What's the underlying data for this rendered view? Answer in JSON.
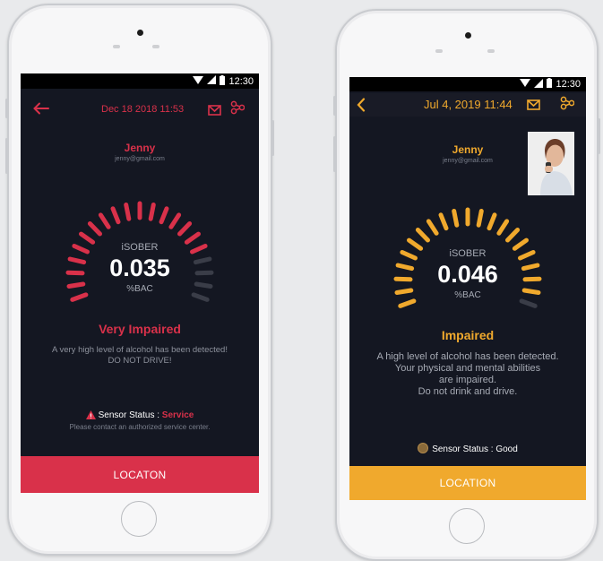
{
  "phones": [
    {
      "status_time": "12:30",
      "date": "Dec 18 2018 11:53",
      "user_name": "Jenny",
      "user_email": "jenny@gmail.com",
      "brand": "iSOBER",
      "reading": "0.035",
      "unit": "%BAC",
      "level_label": "Very Impaired",
      "message_line1": "A very high level of alcohol has been detected!",
      "message_line2": "DO NOT DRIVE!",
      "sensor_label": "Sensor Status : ",
      "sensor_value": "Service",
      "sensor_note": "Please contact an authorized service center.",
      "footer_label": "LOCATON",
      "accent": "#d9314a",
      "gauge_level": 0.82,
      "icons": [
        "back-arrow-icon",
        "mail-icon",
        "share-icon",
        "warning-icon"
      ]
    },
    {
      "status_time": "12:30",
      "date": "Jul 4, 2019 11:44",
      "user_name": "Jenny",
      "user_email": "jenny@gmail.com",
      "brand": "iSOBER",
      "reading": "0.046",
      "unit": "%BAC",
      "level_label": "Impaired",
      "message_line1": "A high level of alcohol has been detected.",
      "message_line2": "Your physical and mental abilities",
      "message_line3": "are impaired.",
      "message_line4": "Do not drink and drive.",
      "sensor_label": "Sensor Status : Good",
      "footer_label": "LOCATION",
      "accent": "#f0a92d",
      "gauge_level": 0.94,
      "icons": [
        "chevron-left-icon",
        "mail-icon",
        "share-icon",
        "status-dot-icon",
        "user-photo"
      ]
    }
  ]
}
